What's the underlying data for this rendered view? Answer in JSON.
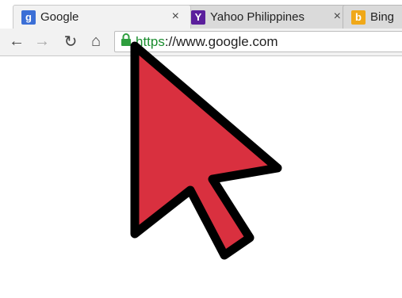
{
  "tabs": [
    {
      "title": "Google",
      "icon": "google-g-icon",
      "active": true,
      "close": "×"
    },
    {
      "title": "Yahoo Philippines",
      "icon": "yahoo-y-icon",
      "active": false,
      "close": "×"
    },
    {
      "title": "Bing",
      "icon": "bing-b-icon",
      "active": false
    }
  ],
  "toolbar": {
    "back": "←",
    "forward": "→",
    "reload": "↻",
    "home": "⌂"
  },
  "omnibox": {
    "scheme": "https",
    "rest": "://www.google.com",
    "secure_icon": "lock-icon"
  },
  "colors": {
    "pointer_fill": "#d9303f",
    "pointer_outline": "#000000",
    "secure_green": "#1a8c2e"
  }
}
